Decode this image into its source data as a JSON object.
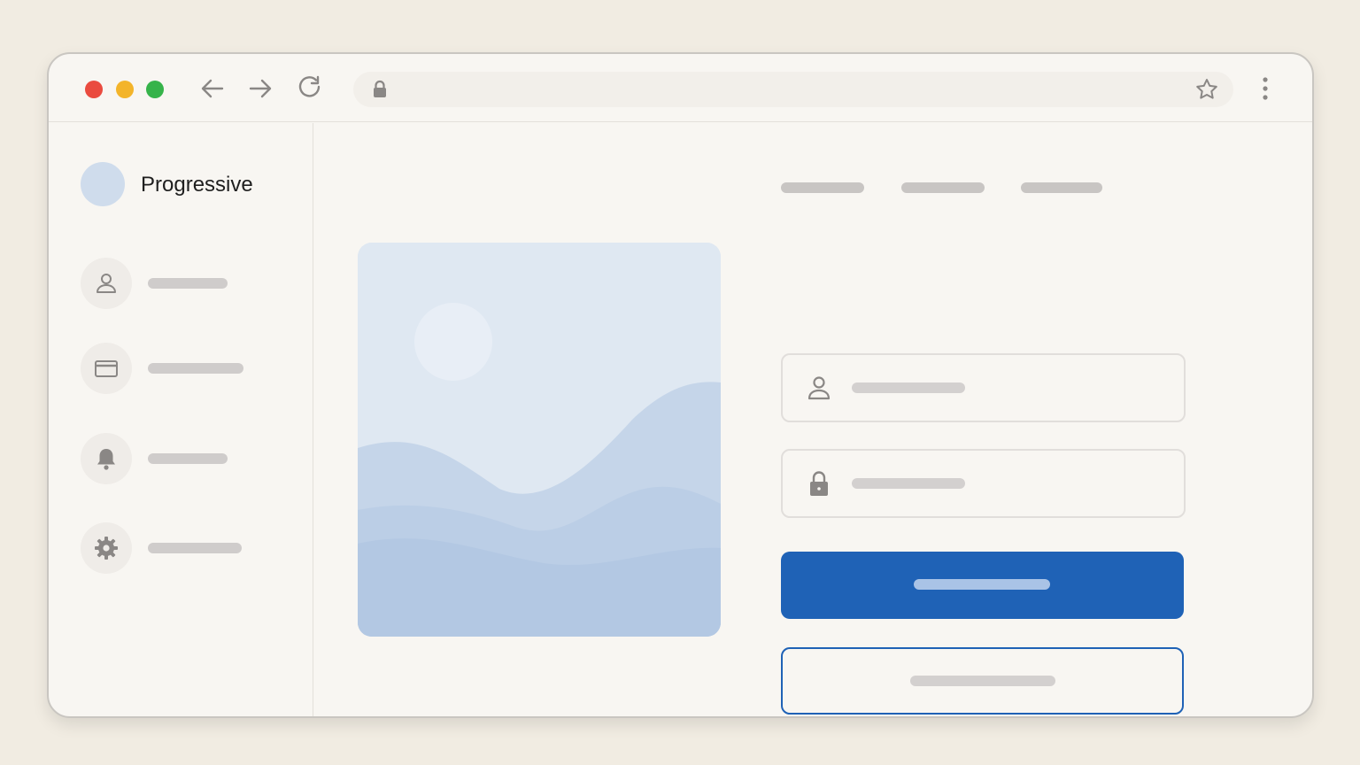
{
  "app": {
    "brand_name": "Progressive"
  },
  "window_controls": [
    "close",
    "minimize",
    "maximize"
  ],
  "toolbar": {
    "icons": [
      "back-arrow-icon",
      "forward-arrow-icon",
      "reload-icon",
      "lock-icon",
      "star-icon",
      "more-vertical-icon"
    ],
    "address_value": ""
  },
  "sidebar": {
    "items": [
      {
        "icon": "user-icon",
        "label": ""
      },
      {
        "icon": "credit-card-icon",
        "label": ""
      },
      {
        "icon": "bell-icon",
        "label": ""
      },
      {
        "icon": "gear-icon",
        "label": ""
      }
    ]
  },
  "main": {
    "top_links": [
      "",
      "",
      ""
    ],
    "hero_image": "landscape-illustration",
    "form": {
      "username_field": {
        "icon": "user-icon",
        "value": ""
      },
      "password_field": {
        "icon": "lock-icon",
        "value": ""
      },
      "primary_button_label": "",
      "secondary_button_label": ""
    }
  },
  "colors": {
    "background": "#f1ece2",
    "window": "#f8f6f2",
    "accent": "#1f62b6",
    "traffic_red": "#ea4b3f",
    "traffic_yellow": "#f3b42a",
    "traffic_green": "#36b34a"
  }
}
